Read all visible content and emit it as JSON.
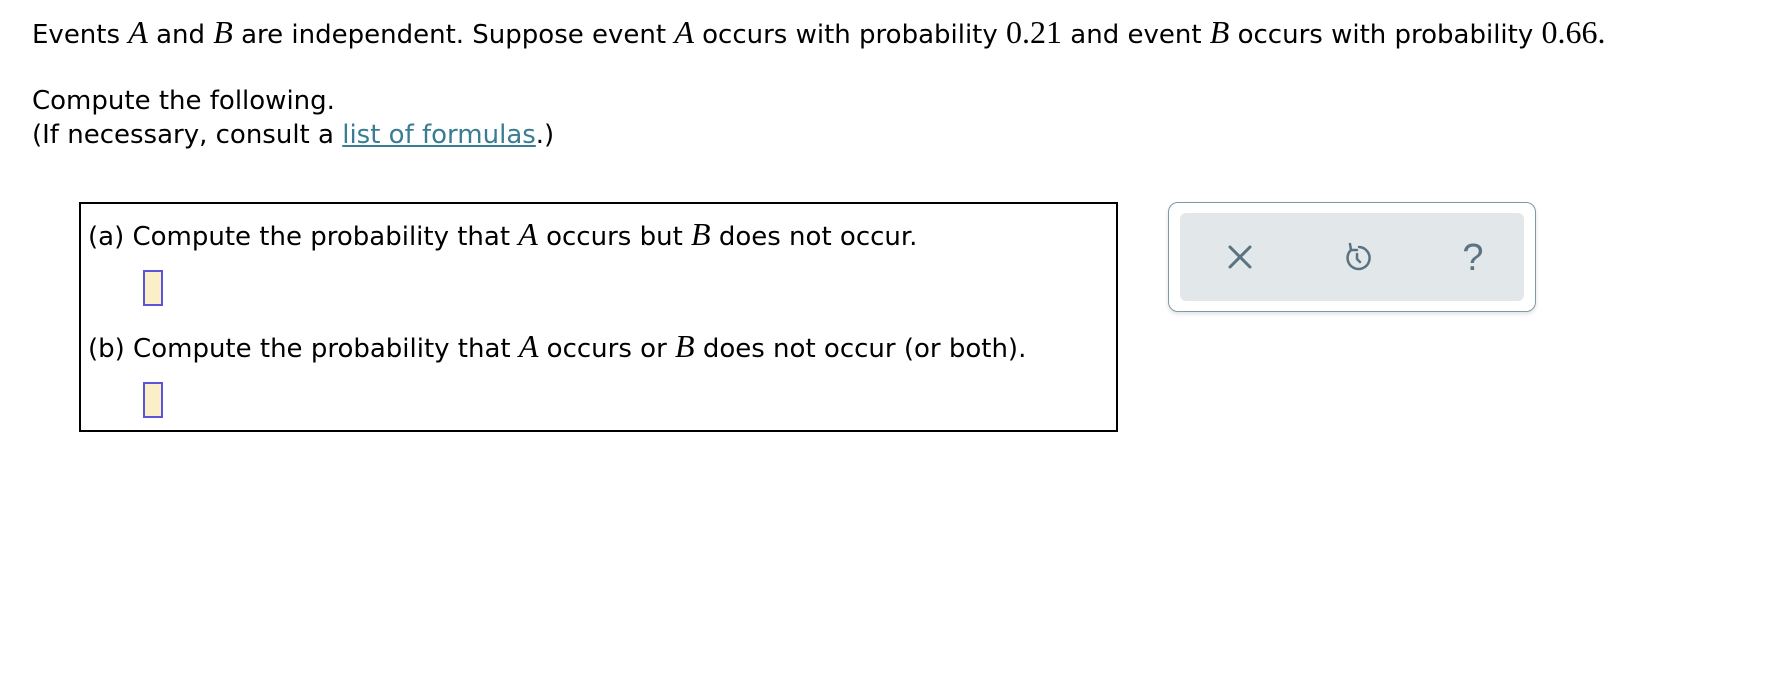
{
  "intro": {
    "p1": "Events ",
    "varA": "A",
    "p2": " and ",
    "varB": "B",
    "p3": " are independent. Suppose event ",
    "varA2": "A",
    "p4": " occurs with probability ",
    "probA": "0.21",
    "p5": " and event ",
    "varB2": "B",
    "p6": " occurs with probability ",
    "probB": "0.66."
  },
  "compute_text": "Compute the following.",
  "consult": {
    "before": "(If necessary, consult a ",
    "link": "list of formulas",
    "after": ".)"
  },
  "questions": [
    {
      "label": "(a) Compute the probability that ",
      "v1": "A",
      "mid": " occurs but ",
      "v2": "B",
      "end": " does not occur.",
      "answer": ""
    },
    {
      "label": "(b) Compute the probability that ",
      "v1": "A",
      "mid": " occurs or ",
      "v2": "B",
      "end": " does not occur (or both).",
      "answer": ""
    }
  ],
  "toolbar": {
    "icons": [
      "close-icon",
      "undo-icon",
      "help-icon"
    ],
    "help_glyph": "?"
  },
  "colors": {
    "link": "#3a7d93",
    "answer_fill": "#fbefc8",
    "answer_border": "#5a55d8",
    "toolbar_bg": "#e2e8ea",
    "icon": "#5b7380"
  }
}
